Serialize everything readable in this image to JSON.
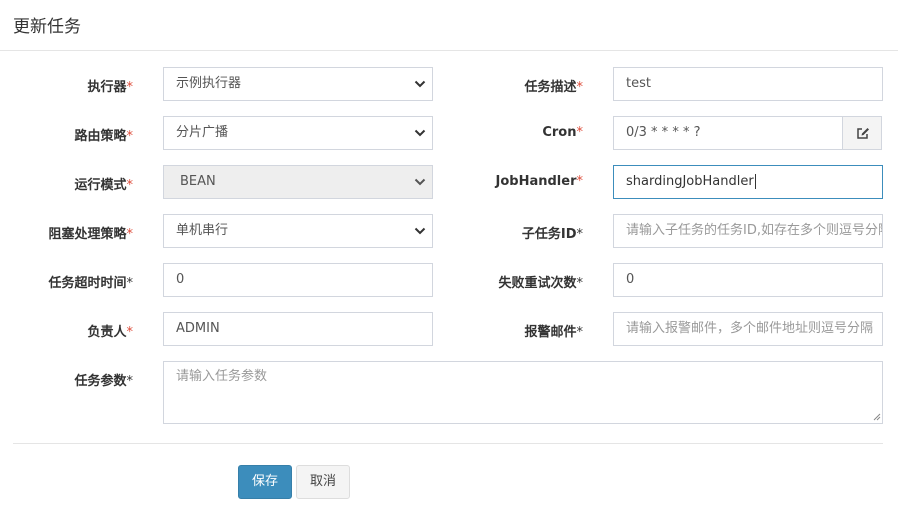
{
  "modal": {
    "title": "更新任务"
  },
  "form": {
    "executor": {
      "label": "执行器",
      "value": "示例执行器"
    },
    "job_desc": {
      "label": "任务描述",
      "value": "test"
    },
    "route_strategy": {
      "label": "路由策略",
      "value": "分片广播"
    },
    "cron": {
      "label": "Cron",
      "value": "0/3 * * * * ?"
    },
    "run_mode": {
      "label": "运行模式",
      "value": "BEAN"
    },
    "job_handler": {
      "label": "JobHandler",
      "value": "shardingJobHandler"
    },
    "block_strategy": {
      "label": "阻塞处理策略",
      "value": "单机串行"
    },
    "child_job_id": {
      "label": "子任务ID",
      "placeholder": "请输入子任务的任务ID,如存在多个则逗号分隔"
    },
    "timeout": {
      "label": "任务超时时间",
      "value": "0"
    },
    "fail_retry": {
      "label": "失败重试次数",
      "value": "0"
    },
    "author": {
      "label": "负责人",
      "value": "ADMIN"
    },
    "alarm_email": {
      "label": "报警邮件",
      "placeholder": "请输入报警邮件，多个邮件地址则逗号分隔"
    },
    "job_param": {
      "label": "任务参数",
      "placeholder": "请输入任务参数"
    },
    "required_mark": "*"
  },
  "buttons": {
    "save": "保存",
    "cancel": "取消"
  },
  "colors": {
    "primary": "#3c8dbc",
    "required": "#dd4b39",
    "border": "#d2d6de"
  }
}
